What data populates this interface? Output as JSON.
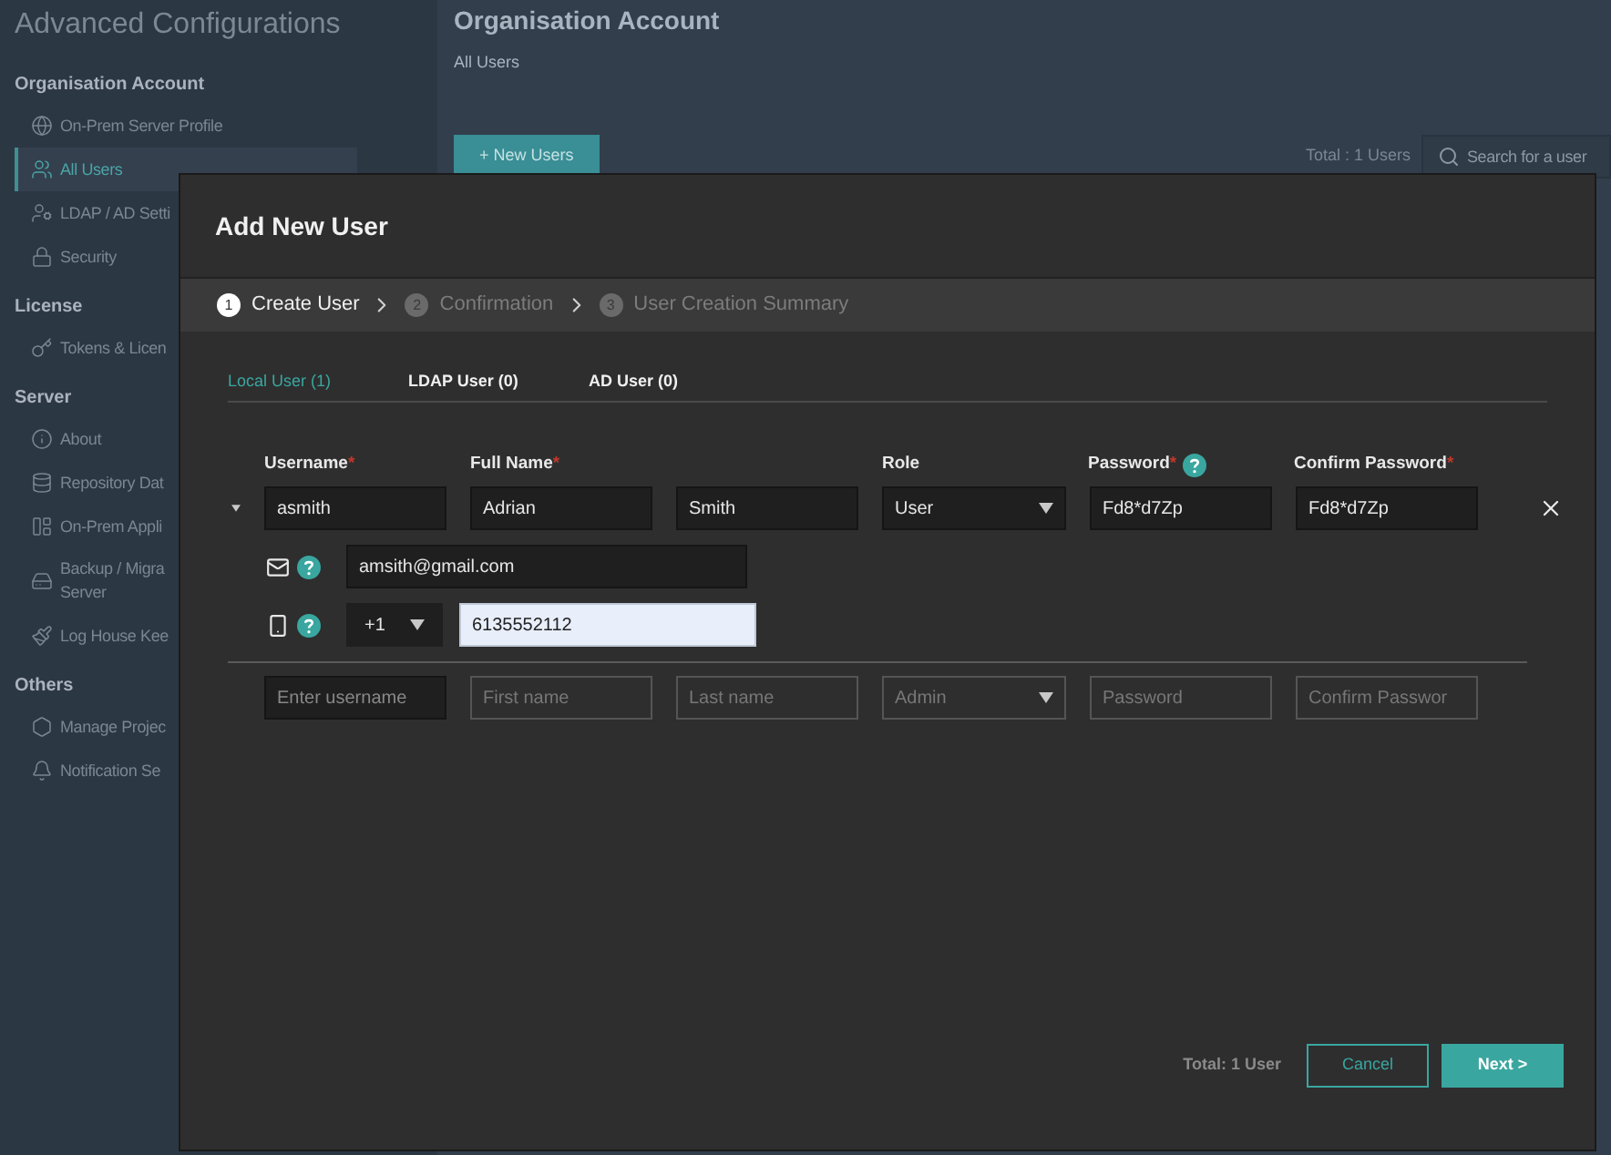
{
  "sidebar": {
    "title": "Advanced Configurations",
    "sections": [
      {
        "heading": "Organisation Account",
        "items": [
          {
            "lines": [
              "On-Prem Server Profile"
            ],
            "selected": false
          },
          {
            "lines": [
              "All Users"
            ],
            "selected": true
          },
          {
            "lines": [
              "LDAP / AD Setti"
            ],
            "selected": false
          },
          {
            "lines": [
              "Security"
            ],
            "selected": false
          }
        ]
      },
      {
        "heading": "License",
        "items": [
          {
            "lines": [
              "Tokens & Licen"
            ],
            "selected": false
          }
        ]
      },
      {
        "heading": "Server",
        "items": [
          {
            "lines": [
              "About"
            ],
            "selected": false
          },
          {
            "lines": [
              "Repository Dat"
            ],
            "selected": false
          },
          {
            "lines": [
              "On-Prem Appli"
            ],
            "selected": false
          },
          {
            "lines": [
              "Backup / Migra",
              "Server"
            ],
            "selected": false
          },
          {
            "lines": [
              "Log House Kee"
            ],
            "selected": false
          }
        ]
      },
      {
        "heading": "Others",
        "items": [
          {
            "lines": [
              "Manage Projec"
            ],
            "selected": false
          },
          {
            "lines": [
              "Notification Se"
            ],
            "selected": false
          }
        ]
      }
    ]
  },
  "header": {
    "title": "Organisation Account",
    "breadcrumb": "All Users"
  },
  "toolbar": {
    "new_button": "+ New Users",
    "total": "Total : 1 Users",
    "search": {
      "placeholder": "Search for a user"
    }
  },
  "dialog": {
    "title": "Add New User",
    "steps": [
      {
        "number": "1",
        "label": "Create User",
        "selected": true
      },
      {
        "number": "2",
        "label": "Confirmation",
        "selected": false
      },
      {
        "number": "3",
        "label": "User Creation Summary",
        "selected": false
      }
    ],
    "tabs": [
      {
        "label": "Local User (1)",
        "selected": true
      },
      {
        "label": "LDAP User (0)",
        "selected": false
      },
      {
        "label": "AD User (0)",
        "selected": false
      }
    ],
    "required_mark": "*",
    "columns": [
      {
        "label": "Username",
        "required": true,
        "help": false
      },
      {
        "label": "Full Name",
        "required": true,
        "help": false
      },
      {
        "label": "Role",
        "required": false,
        "help": false
      },
      {
        "label": "Password",
        "required": true,
        "help": true
      },
      {
        "label": "Confirm Password",
        "required": true,
        "help": false
      }
    ],
    "users": [
      {
        "expanded": true,
        "username": "asmith",
        "first_name": "Adrian",
        "last_name": "Smith",
        "role": "User",
        "password": "Fd8*d7Zp",
        "confirm_password": "Fd8*d7Zp",
        "email": "amsith@gmail.com",
        "phone_code": "+1",
        "phone": "6135552112",
        "phone_focused": true
      }
    ],
    "new_row": {
      "username": {
        "placeholder": "Enter username"
      },
      "first_name": {
        "placeholder": "First name"
      },
      "last_name": {
        "placeholder": "Last name"
      },
      "role": "Admin",
      "password": {
        "placeholder": "Password"
      },
      "confirm_password": {
        "placeholder": "Confirm Passwor"
      }
    },
    "footer": {
      "total": "Total: 1 User",
      "cancel": "Cancel",
      "next": "Next >"
    }
  }
}
